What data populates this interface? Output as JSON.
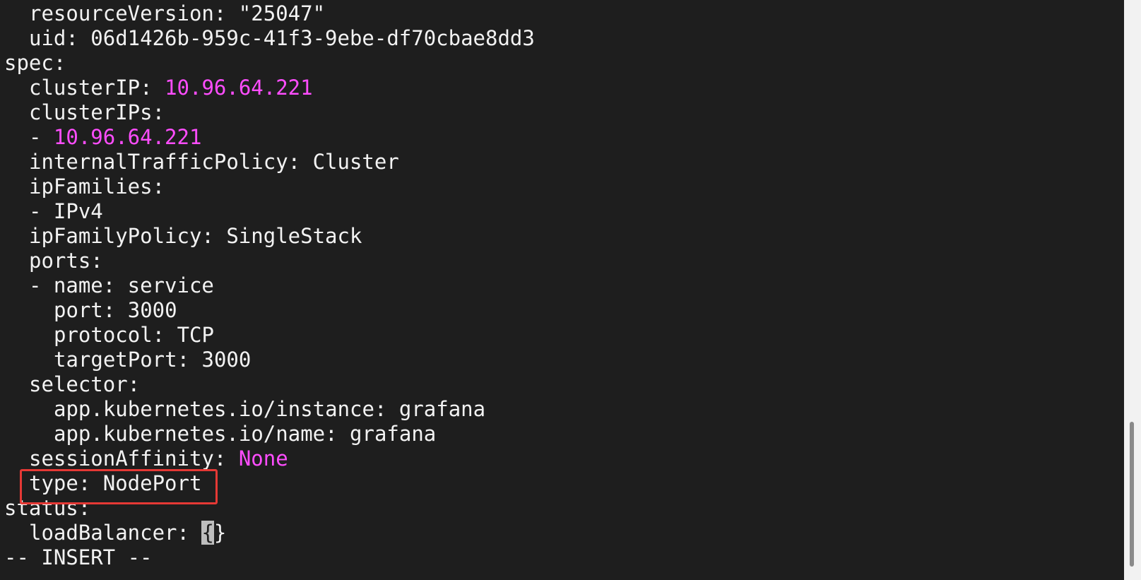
{
  "editor": {
    "lines": [
      {
        "text": "resourceVersion: \"25047\""
      },
      {
        "text": "uid: 06d1426b-959c-41f3-9ebe-df70cbae8dd3"
      },
      {
        "text": "spec:"
      },
      {
        "key": "clusterIP: ",
        "value": "10.96.64.221"
      },
      {
        "text": "clusterIPs:"
      },
      {
        "key": "- ",
        "value": "10.96.64.221"
      },
      {
        "text": "internalTrafficPolicy: Cluster"
      },
      {
        "text": "ipFamilies:"
      },
      {
        "text": "- IPv4"
      },
      {
        "text": "ipFamilyPolicy: SingleStack"
      },
      {
        "text": "ports:"
      },
      {
        "text": "- name: service"
      },
      {
        "text": "port: 3000"
      },
      {
        "text": "protocol: TCP"
      },
      {
        "text": "targetPort: 3000"
      },
      {
        "text": "selector:"
      },
      {
        "text": "app.kubernetes.io/instance: grafana"
      },
      {
        "text": "app.kubernetes.io/name: grafana"
      },
      {
        "key": "sessionAffinity: ",
        "value": "None"
      },
      {
        "text": "type: NodePort"
      },
      {
        "text": "status:"
      },
      {
        "key": "loadBalancer: ",
        "cursor_char": "{",
        "rest": "}"
      }
    ],
    "mode_line": "-- INSERT --"
  },
  "colors": {
    "background": "#1e1e1e",
    "text": "#f2f2f2",
    "value_highlight": "#ff4dff",
    "annotation_box": "#e53935"
  },
  "scrollbar": {
    "position_fraction": 0.73,
    "visible_fraction": 0.25
  }
}
